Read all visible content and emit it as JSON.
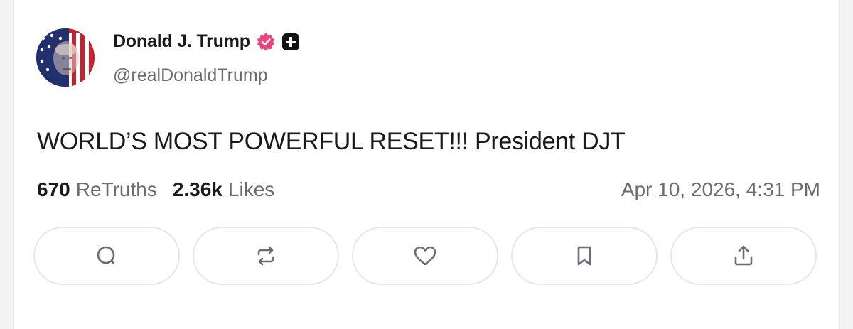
{
  "post": {
    "author": {
      "display_name": "Donald J. Trump",
      "handle": "@realDonaldTrump",
      "verified_icon": "verified-badge-icon",
      "plus_icon": "plus-badge-icon",
      "verified_color": "#e8467c"
    },
    "text": "WORLD’S MOST POWERFUL RESET!!! President DJT",
    "stats": {
      "retruths_count": "670",
      "retruths_label": "ReTruths",
      "likes_count": "2.36k",
      "likes_label": "Likes"
    },
    "timestamp": "Apr 10, 2026, 4:31 PM"
  },
  "actions": [
    {
      "name": "reply",
      "icon": "comment-icon"
    },
    {
      "name": "retruth",
      "icon": "repost-icon"
    },
    {
      "name": "like",
      "icon": "heart-icon"
    },
    {
      "name": "bookmark",
      "icon": "bookmark-icon"
    },
    {
      "name": "share",
      "icon": "share-icon"
    }
  ],
  "colors": {
    "text_primary": "#1a1a1a",
    "text_secondary": "#6b6b78",
    "button_border": "#e7e7eb"
  }
}
